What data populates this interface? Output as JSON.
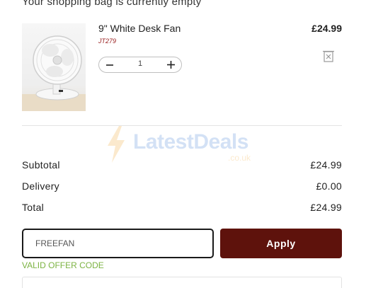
{
  "bag": {
    "heading": "Your shopping bag is currently empty"
  },
  "item": {
    "name": "9\" White Desk Fan",
    "sku": "JT279",
    "price": "£24.99",
    "quantity": "1"
  },
  "watermark": {
    "brand": "LatestDeals",
    "domain": ".co.uk"
  },
  "totals": {
    "subtotal_label": "Subtotal",
    "subtotal_value": "£24.99",
    "delivery_label": "Delivery",
    "delivery_value": "£0.00",
    "total_label": "Total",
    "total_value": "£24.99"
  },
  "promo": {
    "code_value": "FREEFAN",
    "apply_label": "Apply",
    "status_message": "VALID OFFER CODE"
  },
  "colors": {
    "accent_dark_red": "#5e120c",
    "valid_green": "#7cb342",
    "sku_red": "#9b2424"
  }
}
